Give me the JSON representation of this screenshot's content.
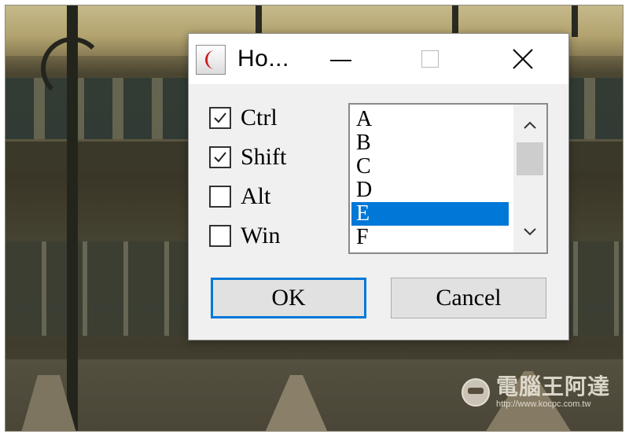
{
  "dialog": {
    "title": "Ho...",
    "icon": "crescent-moon-app-icon",
    "controls": {
      "minimize": "minimize-icon",
      "maximize": "maximize-icon",
      "close": "close-icon"
    }
  },
  "checkboxes": [
    {
      "label": "Ctrl",
      "checked": true
    },
    {
      "label": "Shift",
      "checked": true
    },
    {
      "label": "Alt",
      "checked": false
    },
    {
      "label": "Win",
      "checked": false
    }
  ],
  "listbox": {
    "items": [
      "A",
      "B",
      "C",
      "D",
      "E",
      "F"
    ],
    "selected_item": "E"
  },
  "buttons": {
    "ok_label": "OK",
    "cancel_label": "Cancel"
  },
  "watermark": {
    "title": "電腦王阿達",
    "url": "http://www.kocpc.com.tw"
  },
  "colors": {
    "selection": "#0078d7",
    "dialog_bg": "#f0f0f0",
    "focus_border": "#0078d7"
  }
}
